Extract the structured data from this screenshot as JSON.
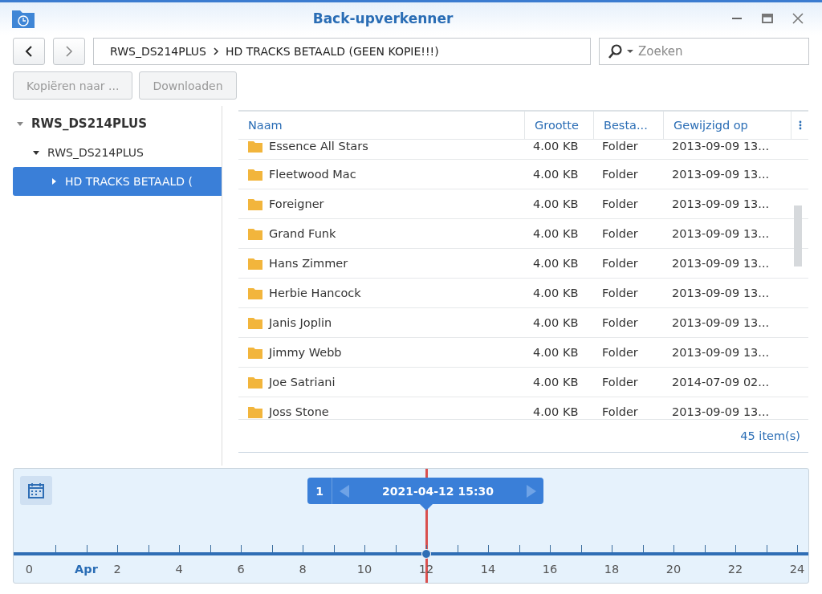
{
  "window": {
    "title": "Back-upverkenner"
  },
  "path": [
    "RWS_DS214PLUS",
    "HD TRACKS BETAALD (GEEN KOPIE!!!)"
  ],
  "search": {
    "placeholder": "Zoeken"
  },
  "actions": [
    {
      "label": "Kopiëren naar ...",
      "disabled": true
    },
    {
      "label": "Downloaden",
      "disabled": true
    }
  ],
  "tree": [
    {
      "label": "RWS_DS214PLUS",
      "expanded": true,
      "selected": false,
      "children": [
        {
          "label": "RWS_DS214PLUS",
          "expanded": true,
          "selected": false,
          "children": [
            {
              "label": "HD TRACKS BETAALD (",
              "expanded": false,
              "selected": true
            }
          ]
        }
      ]
    }
  ],
  "table": {
    "columns": [
      "Naam",
      "Grootte",
      "Besta...",
      "Gewijzigd op"
    ],
    "rows": [
      [
        "Essence All Stars",
        "4.00 KB",
        "Folder",
        "2013-09-09 13..."
      ],
      [
        "Fleetwood Mac",
        "4.00 KB",
        "Folder",
        "2013-09-09 13..."
      ],
      [
        "Foreigner",
        "4.00 KB",
        "Folder",
        "2013-09-09 13..."
      ],
      [
        "Grand Funk",
        "4.00 KB",
        "Folder",
        "2013-09-09 13..."
      ],
      [
        "Hans Zimmer",
        "4.00 KB",
        "Folder",
        "2013-09-09 13..."
      ],
      [
        "Herbie Hancock",
        "4.00 KB",
        "Folder",
        "2013-09-09 13..."
      ],
      [
        "Janis Joplin",
        "4.00 KB",
        "Folder",
        "2013-09-09 13..."
      ],
      [
        "Jimmy Webb",
        "4.00 KB",
        "Folder",
        "2013-09-09 13..."
      ],
      [
        "Joe Satriani",
        "4.00 KB",
        "Folder",
        "2014-07-09 02..."
      ],
      [
        "Joss Stone",
        "4.00 KB",
        "Folder",
        "2013-09-09 13..."
      ]
    ],
    "count": "45 item(s)"
  },
  "timeline": {
    "version": "1",
    "datetime": "2021-04-12 15:30",
    "labels": [
      {
        "text": "0",
        "kind": "hour"
      },
      {
        "text": "Apr",
        "kind": "month"
      },
      {
        "text": "2",
        "kind": "hour"
      },
      {
        "text": "4",
        "kind": "hour"
      },
      {
        "text": "6",
        "kind": "hour"
      },
      {
        "text": "8",
        "kind": "hour"
      },
      {
        "text": "10",
        "kind": "hour"
      },
      {
        "text": "12",
        "kind": "hour"
      },
      {
        "text": "14",
        "kind": "hour"
      },
      {
        "text": "16",
        "kind": "hour"
      },
      {
        "text": "18",
        "kind": "hour"
      },
      {
        "text": "20",
        "kind": "hour"
      },
      {
        "text": "22",
        "kind": "hour"
      },
      {
        "text": "24",
        "kind": "hour"
      }
    ]
  }
}
